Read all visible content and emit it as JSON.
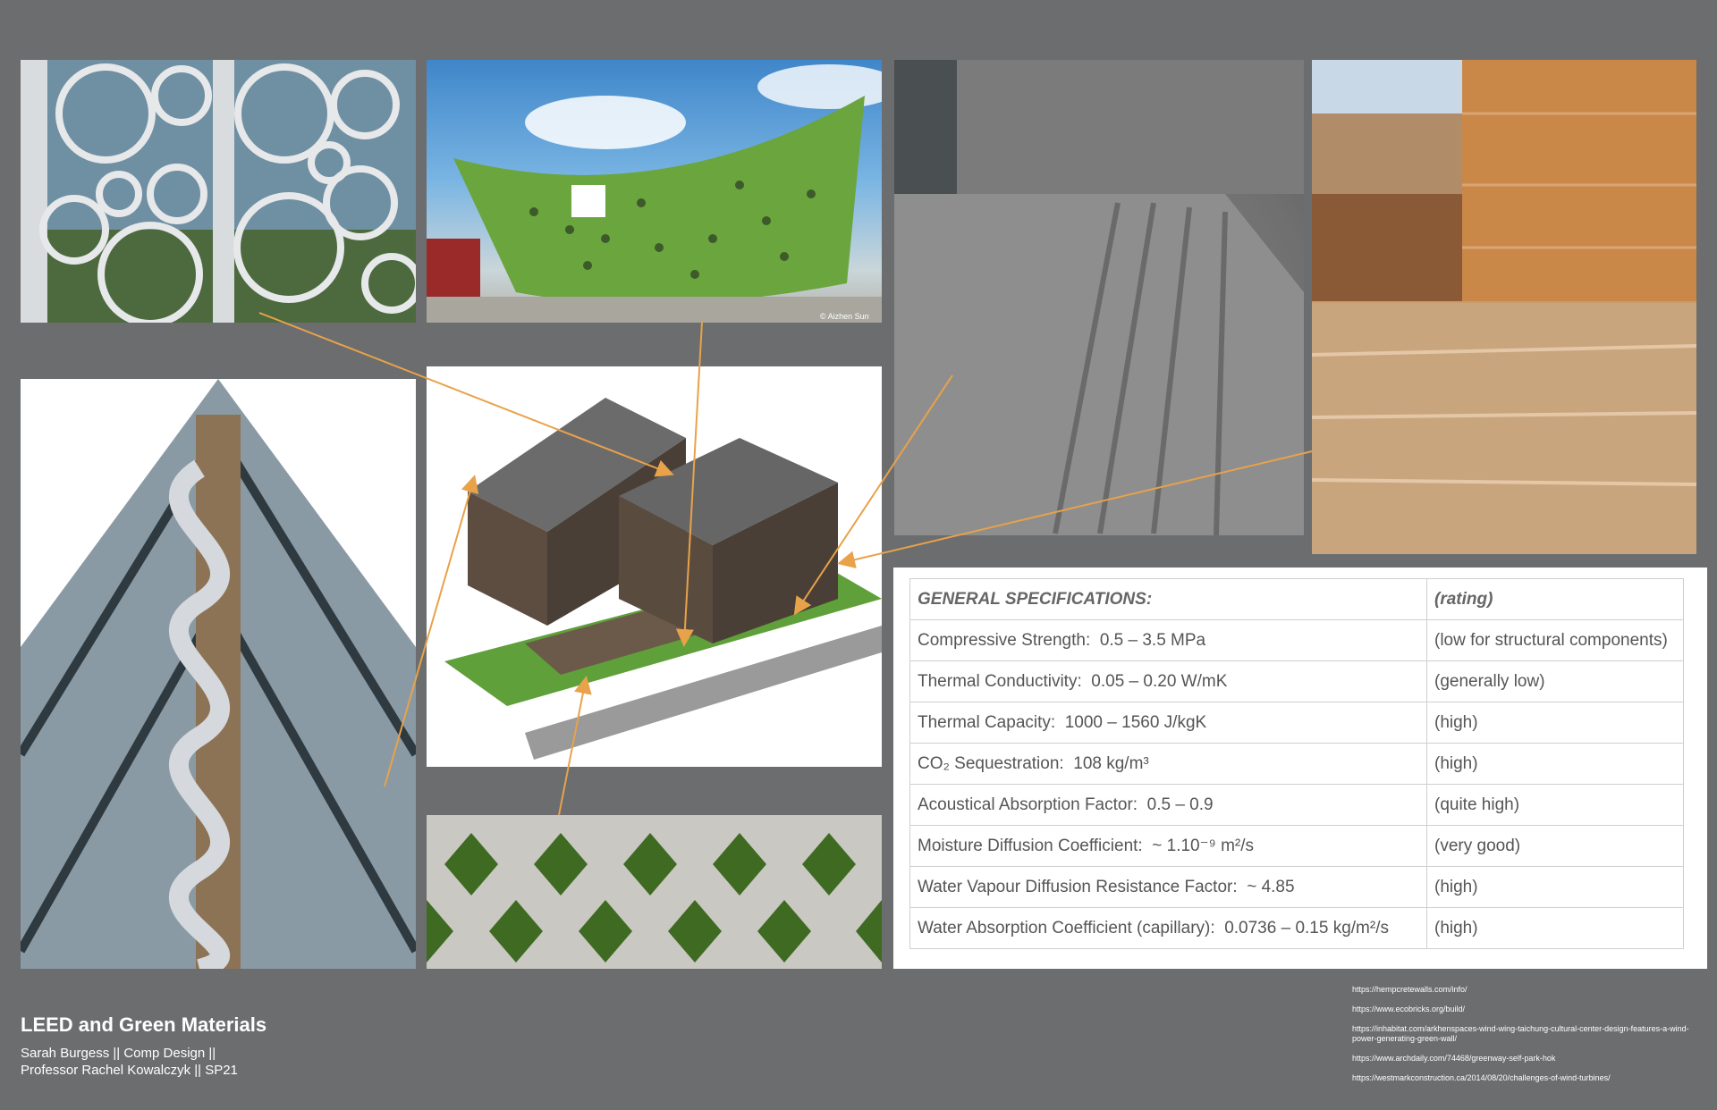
{
  "title": "LEED and Green Materials",
  "author_line": "Sarah Burgess || Comp Design ||",
  "professor_line": "Professor Rachel Kowalczyk || SP21",
  "watermark": "© Aizhen Sun",
  "specs": {
    "header_label": "GENERAL SPECIFICATIONS:",
    "header_rating": "(rating)",
    "rows": [
      {
        "label": "Compressive Strength:",
        "value": "0.5  –  3.5 MPa",
        "rating": "(low for structural components)"
      },
      {
        "label": "Thermal Conductivity:",
        "value": "0.05  –  0.20 W/mK",
        "rating": "(generally low)"
      },
      {
        "label": "Thermal Capacity:",
        "value": "1000  –  1560  J/kgK",
        "rating": "(high)"
      },
      {
        "label": "CO₂ Sequestration:",
        "value": "108 kg/m³",
        "rating": "(high)"
      },
      {
        "label": "Acoustical Absorption Factor:",
        "value": "0.5  –  0.9",
        "rating": "(quite high)"
      },
      {
        "label": "Moisture Diffusion Coefficient:",
        "value": "~ 1.10⁻⁹ m²/s",
        "rating": "(very good)"
      },
      {
        "label": "Water Vapour Diffusion Resistance Factor:",
        "value": "~ 4.85",
        "rating": "(high)"
      },
      {
        "label": "Water Absorption Coefficient (capillary):",
        "value": "0.0736  –  0.15 kg/m²/s",
        "rating": "(high)"
      }
    ]
  },
  "references": [
    "https://hempcretewalls.com/info/",
    "https://www.ecobricks.org/build/",
    "https://inhabitat.com/arkhenspaces-wind-wing-taichung-cultural-center-design-features-a-wind-power-generating-green-wall/",
    "https://www.archdaily.com/74468/greenway-self-park-hok",
    "https://westmarkconstruction.ca/2014/08/20/challenges-of-wind-turbines/"
  ],
  "colors": {
    "background": "#6b6d6f",
    "arrow": "#e8a24a",
    "table_border": "#cfcfcf"
  }
}
